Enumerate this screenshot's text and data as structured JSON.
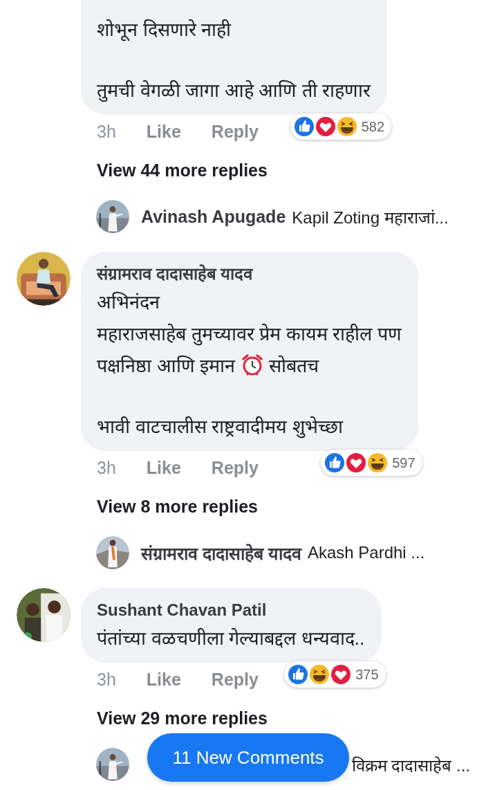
{
  "comments": [
    {
      "paragraphs": [
        [
          [
            "शोभून दिसणारे नाही"
          ]
        ],
        [
          [
            "तुमची वेगळी जागा आहे आणि ती राहणार"
          ]
        ]
      ],
      "time": "3h",
      "like": "Like",
      "reply": "Reply",
      "reactions": {
        "icons": [
          {
            "kind": "like"
          },
          {
            "kind": "love"
          },
          {
            "kind": "haha"
          }
        ],
        "count": "582"
      },
      "view_replies": "View 44 more replies",
      "reply_preview": {
        "author": "Avinash Apugade",
        "text": "Kapil Zoting महाराजां..."
      }
    },
    {
      "author": "संग्रामराव दादासाहेब यादव",
      "paragraphs": [
        [
          [
            "अभिनंदन"
          ],
          [
            "महाराजसाहेब तुमच्यावर प्रेम कायम राहील पण"
          ],
          [
            "पक्षनिष्ठा आणि इमान ",
            {
              "kind": "alarm-clock"
            },
            " सोबतच"
          ]
        ],
        [
          [
            "भावी वाटचालीस राष्ट्रवादीमय शुभेच्छा"
          ]
        ]
      ],
      "time": "3h",
      "like": "Like",
      "reply": "Reply",
      "reactions": {
        "icons": [
          {
            "kind": "like"
          },
          {
            "kind": "love"
          },
          {
            "kind": "haha"
          }
        ],
        "count": "597"
      },
      "view_replies": "View 8 more replies",
      "reply_preview": {
        "author": "संग्रामराव दादासाहेब यादव",
        "text": "Akash Pardhi  ..."
      }
    },
    {
      "author": "Sushant Chavan Patil",
      "paragraphs": [
        [
          [
            "पंतांच्या वळचणीला गेल्याबद्दल धन्यवाद.."
          ]
        ]
      ],
      "time": "3h",
      "like": "Like",
      "reply": "Reply",
      "reactions": {
        "icons": [
          {
            "kind": "like"
          },
          {
            "kind": "haha"
          },
          {
            "kind": "love"
          }
        ],
        "count": "375"
      },
      "view_replies": "View 29 more replies",
      "reply_preview": {
        "text": "विक्रम दादासाहेब ..."
      }
    }
  ],
  "new_comments_button": "11 New Comments"
}
